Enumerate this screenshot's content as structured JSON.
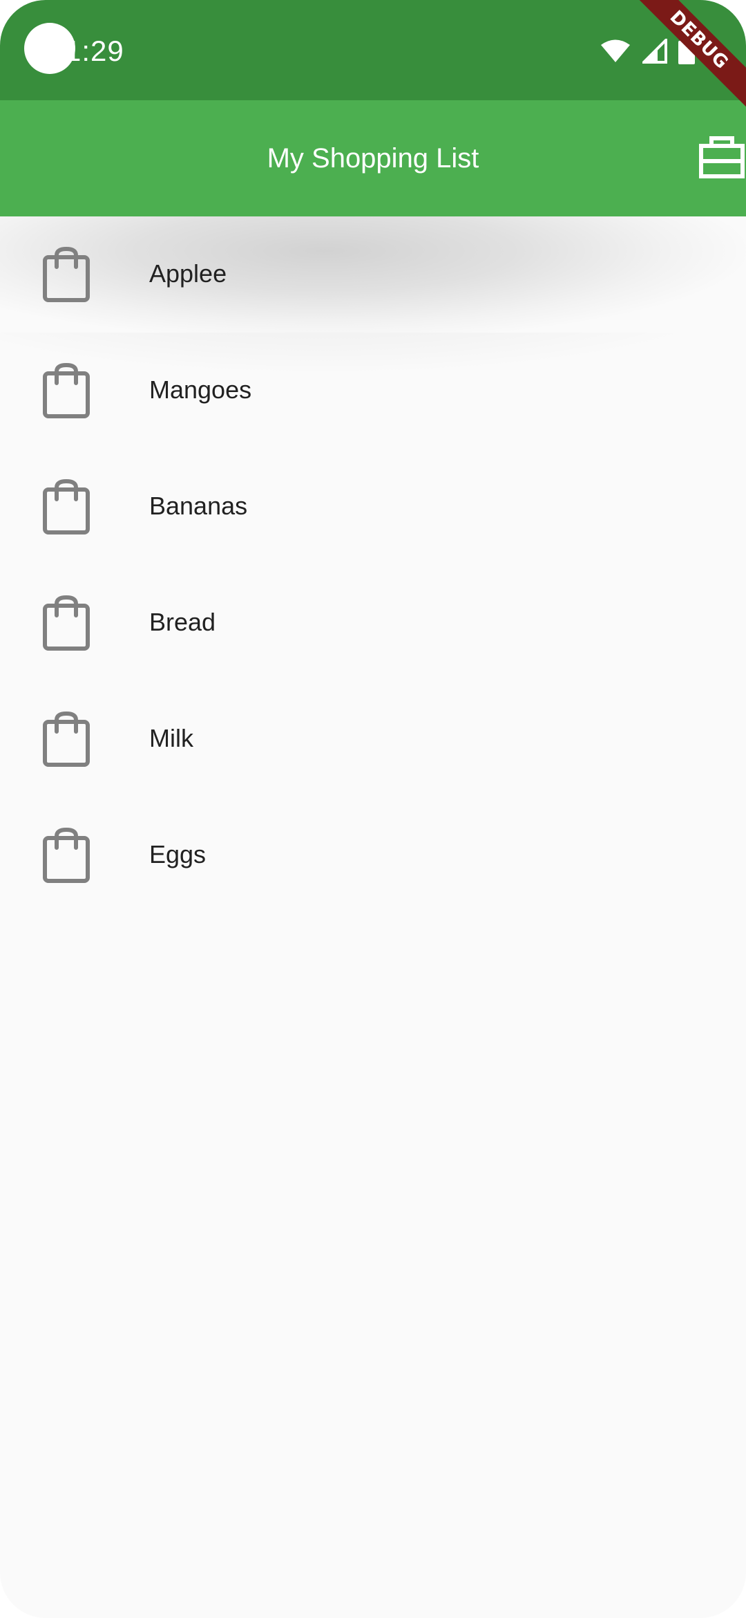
{
  "status_bar": {
    "time": "1:29",
    "icons": [
      "wifi-icon",
      "cellular-signal-icon",
      "battery-icon"
    ]
  },
  "debug_banner": "DEBUG",
  "app_bar": {
    "title": "My Shopping List",
    "action_icon": "briefcase-icon",
    "color": "#4caf50",
    "status_color": "#388e3c"
  },
  "list": {
    "item_icon": "shopping-bag-icon",
    "items": [
      {
        "label": "Applee"
      },
      {
        "label": "Mangoes"
      },
      {
        "label": "Bananas"
      },
      {
        "label": "Bread"
      },
      {
        "label": "Milk"
      },
      {
        "label": "Eggs"
      }
    ]
  }
}
